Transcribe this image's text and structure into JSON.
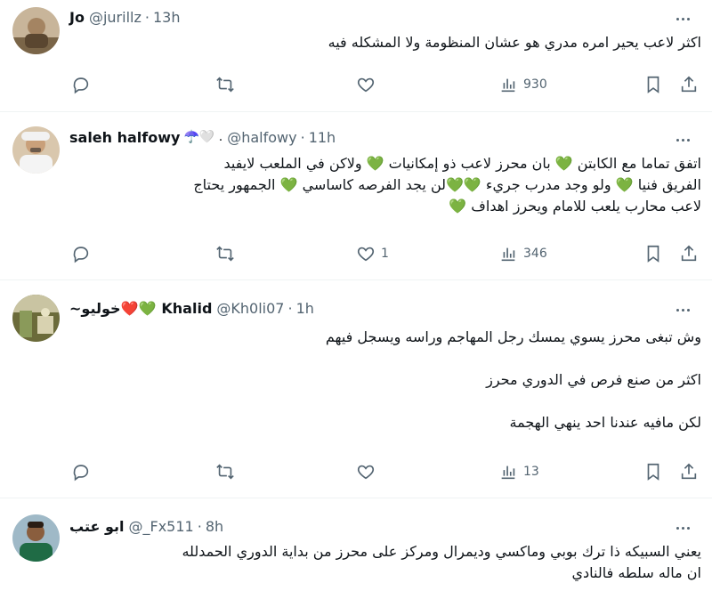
{
  "tweets": [
    {
      "name": "Jo",
      "name_suffix": "",
      "handle": "@jurillz",
      "dot": "·",
      "time": "13h",
      "lines": [
        "اكثر لاعب يحير امره مدري هو عشان المنظومة ولا المشكله فيه"
      ],
      "stats": {
        "replies": "",
        "retweets": "",
        "likes": "",
        "views": "930"
      }
    },
    {
      "name": "saleh halfowy",
      "name_suffix": "☂️🤍 .",
      "handle": "@halfowy",
      "dot": "·",
      "time": "11h",
      "lines": [
        "اتفق تماما مع الكابتن 💚 بان محرز لاعب ذو إمكانيات 💚 ولاكن في الملعب لايفيد",
        "الفريق فنيا 💚 ولو وجد مدرب جريء 💚💚لن يجد الفرصه كاساسي 💚 الجمهور يحتاج",
        "لاعب محارب يلعب للامام ويحرز اهداف 💚"
      ],
      "stats": {
        "replies": "",
        "retweets": "",
        "likes": "1",
        "views": "346"
      }
    },
    {
      "name": "Khalid",
      "name_prefix": "~خوليو❤️💚",
      "handle": "@Kh0li07",
      "dot": "·",
      "time": "1h",
      "paragraphs": [
        "وش تبغى محرز يسوي يمسك رجل المهاجم وراسه ويسجل فيهم",
        "اكثر من صنع فرص في الدوري محرز",
        "لكن مافيه عندنا احد ينهي الهجمة"
      ],
      "stats": {
        "replies": "",
        "retweets": "",
        "likes": "",
        "views": "13"
      }
    },
    {
      "name": "ابو عتب",
      "handle": "@_Fx511",
      "dot": "·",
      "time": "8h",
      "lines": [
        "يعني السبيكه ذا ترك بوبي وماكسي وديمرال ومركز على محرز من بداية الدوري الحمدلله",
        "ان ماله سلطه فالنادي"
      ]
    }
  ],
  "colors": {
    "text": "#0f1419",
    "secondary": "#536471",
    "border": "#eff3f4",
    "heart_green": "#3fb34f",
    "heart_red": "#e0245e"
  }
}
